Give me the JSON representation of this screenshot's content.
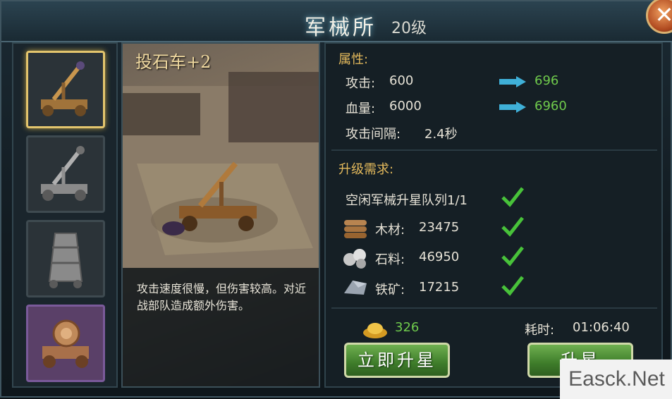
{
  "window": {
    "title": "军械所",
    "level": "20级",
    "close_glyph": "✕"
  },
  "unit_name": "投石车+2",
  "description": "攻击速度很慢，但伤害较高。对近战部队造成额外伤害。",
  "sidebar": {
    "slots": [
      {
        "icon": "catapult-icon",
        "selected": true
      },
      {
        "icon": "catapult-gray-icon",
        "selected": false
      },
      {
        "icon": "siege-tower-icon",
        "selected": false
      },
      {
        "icon": "ram-cart-icon",
        "selected": false
      }
    ]
  },
  "attributes": {
    "heading": "属性:",
    "attack_label": "攻击:",
    "attack_value": "600",
    "attack_next": "696",
    "hp_label": "血量:",
    "hp_value": "6000",
    "hp_next": "6960",
    "interval_label": "攻击间隔:",
    "interval_value": "2.4秒"
  },
  "requirements": {
    "heading": "升级需求:",
    "queue_text": "空闲军械升星队列1/1",
    "wood_label": "木材:",
    "wood_value": "23475",
    "stone_label": "石料:",
    "stone_value": "46950",
    "iron_label": "铁矿:",
    "iron_value": "17215"
  },
  "footer": {
    "gold_value": "326",
    "time_label": "耗时:",
    "time_value": "01:06:40",
    "instant_button": "立即升星",
    "upgrade_button": "升星"
  },
  "watermark": "Easck.Net",
  "colors": {
    "accent_gold": "#e3b95c",
    "green": "#6fca4c",
    "arrow": "#3fb0d8"
  }
}
